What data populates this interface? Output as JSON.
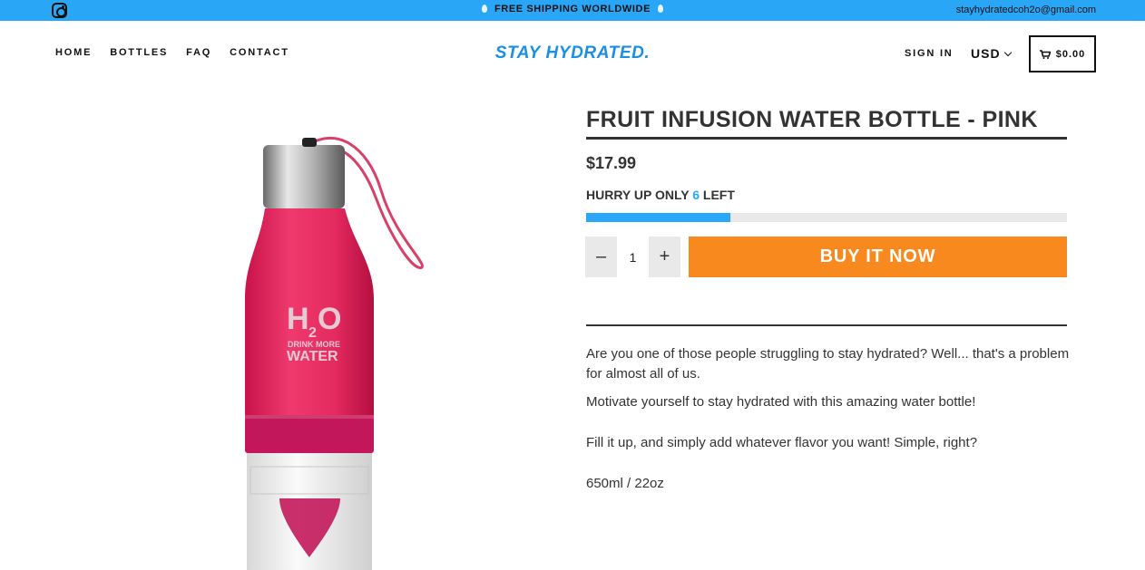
{
  "topbar": {
    "announcement": "FREE SHIPPING WORLDWIDE",
    "email": "stayhydratedcoh2o@gmail.com",
    "social_icon": "instagram-icon"
  },
  "nav": {
    "items": [
      "HOME",
      "BOTTLES",
      "FAQ",
      "CONTACT"
    ]
  },
  "header": {
    "logo": "STAY HYDRATED.",
    "sign_in": "SIGN IN",
    "currency": "USD",
    "cart_total": "$0.00",
    "cart_icon": "cart-icon"
  },
  "product": {
    "title": "FRUIT INFUSION WATER BOTTLE - PINK",
    "price": "$17.99",
    "hurry_prefix": "HURRY UP ONLY ",
    "stock_left": "6",
    "hurry_suffix": " LEFT",
    "stock_fraction": 0.3,
    "quantity": "1",
    "minus_label": "–",
    "plus_label": "+",
    "buy_label": "BUY IT NOW",
    "image_text": {
      "brand": "H",
      "subscript": "2",
      "brand_end": "O",
      "line1": "DRINK MORE",
      "line2": "WATER"
    },
    "description": [
      " Are you one of those people struggling to stay hydrated? Well... that's a problem for almost all of us.",
      "Motivate yourself to stay hydrated with this amazing water bottle!",
      "Fill it up, and simply add whatever flavor you want! Simple, right?",
      "650ml / 22oz"
    ]
  },
  "colors": {
    "accent_blue": "#2aa6f7",
    "logo_blue": "#1a8fe3",
    "buy_orange": "#f7891f",
    "bottle_pink": "#e8245c"
  }
}
